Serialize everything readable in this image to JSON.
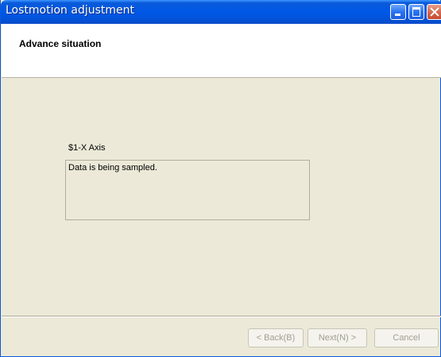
{
  "window": {
    "title": "Lostmotion adjustment"
  },
  "header": {
    "title": "Advance situation"
  },
  "main": {
    "axis_label": "$1-X Axis",
    "status_message": "Data is being sampled."
  },
  "footer": {
    "back_label": "< Back(B)",
    "next_label": "Next(N) >",
    "cancel_label": "Cancel"
  },
  "icons": {
    "minimize": "minimize-icon",
    "maximize": "maximize-icon",
    "close": "close-icon"
  },
  "colors": {
    "titlebar": "#0058e6",
    "dialog_bg": "#ece9d8",
    "disabled_text": "#a19f92"
  }
}
